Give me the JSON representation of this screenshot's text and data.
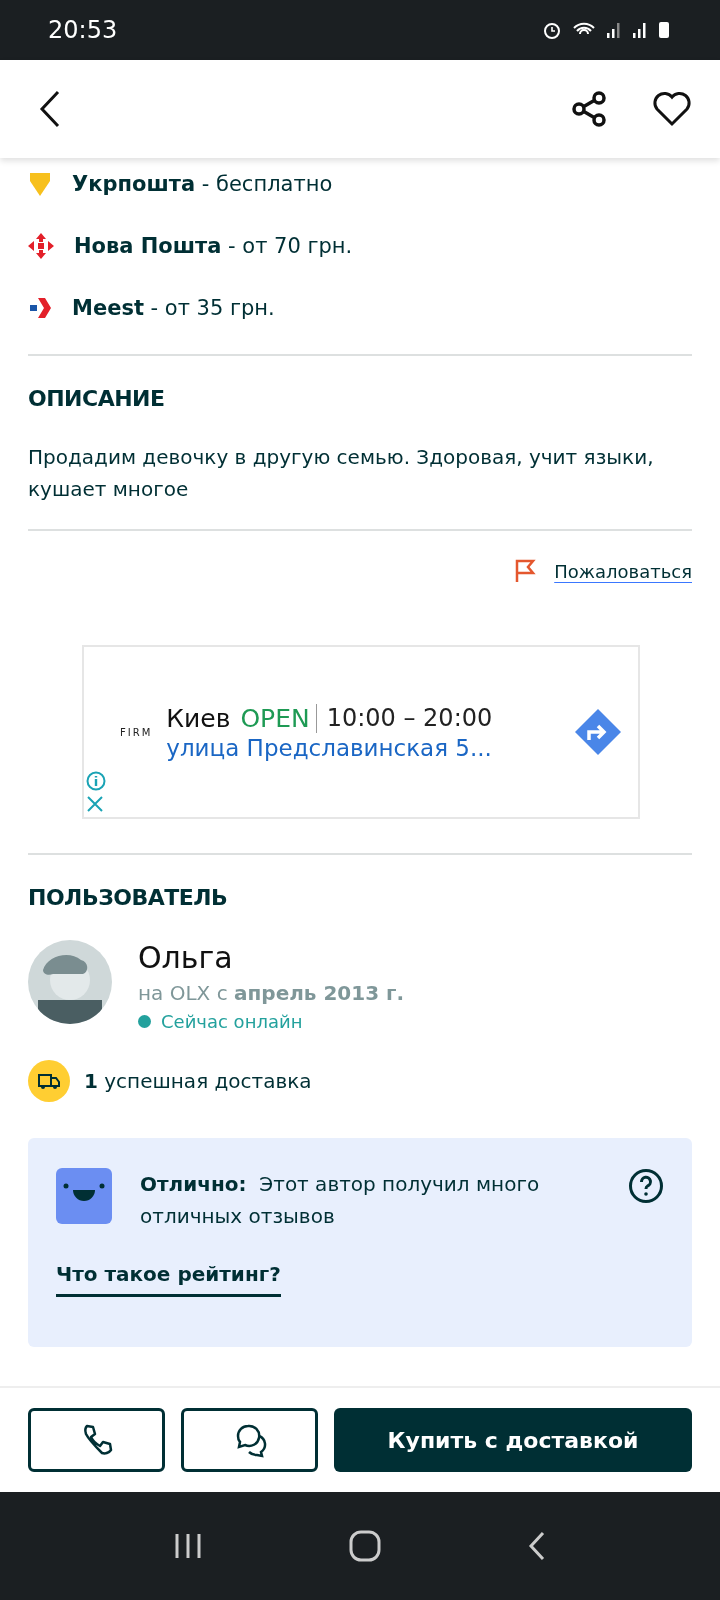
{
  "status_bar": {
    "time": "20:53"
  },
  "shipping": [
    {
      "kind": "ukrposhta",
      "text": "**Укрпошта** - бесплатно"
    },
    {
      "kind": "novaposhta",
      "text": "**Нова Пошта** - от 70 грн."
    },
    {
      "kind": "meest",
      "text": "**Meest** - от 35 грн."
    }
  ],
  "description": {
    "heading": "ОПИСАНИЕ",
    "text": "Продадим девочку в другую семью. Здоровая, учит языки, кушает многое"
  },
  "report": {
    "label": "Пожаловаться"
  },
  "ad": {
    "logo": "FIRM",
    "city": "Киев",
    "status": "OPEN",
    "hours": "10:00 – 20:00",
    "address": "улица Предславинская 5..."
  },
  "user": {
    "heading": "ПОЛЬЗОВАТЕЛЬ",
    "name": "Ольга",
    "since": "на OLX с **апрель 2013 г.**",
    "online": true,
    "online_label": "Сейчас онлайн",
    "deliveries": "**1** успешная доставка"
  },
  "rating": {
    "text": "**Отлично:**  Этот автор получил много отличных отзывов",
    "link": "Что такое рейтинг?"
  },
  "actions": {
    "buy": "Купить с доставкой"
  }
}
